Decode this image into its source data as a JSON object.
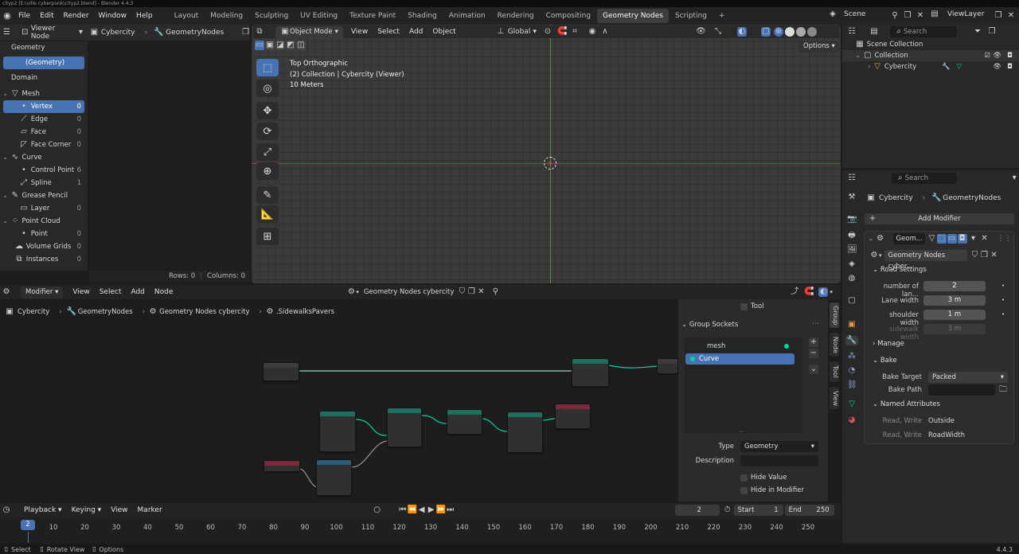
{
  "titlebar": {
    "text": "cityp2 [E:\\ville cyberpunk\\cityp2.blend] - Blender 4.4.3"
  },
  "menu": [
    "File",
    "Edit",
    "Render",
    "Window",
    "Help"
  ],
  "workspaces": [
    "Layout",
    "Modeling",
    "Sculpting",
    "UV Editing",
    "Texture Paint",
    "Shading",
    "Animation",
    "Rendering",
    "Compositing",
    "Geometry Nodes",
    "Scripting"
  ],
  "active_workspace": "Geometry Nodes",
  "scene": {
    "name": "Scene",
    "view_layer": "ViewLayer"
  },
  "spreadsheet": {
    "viewer_node": "Viewer Node",
    "object": "Cybercity",
    "modifier": "GeometryNodes",
    "geometry_label": "Geometry",
    "geometry_item": "(Geometry)",
    "domain_label": "Domain",
    "mesh": {
      "label": "Mesh",
      "items": [
        {
          "label": "Vertex",
          "count": "0"
        },
        {
          "label": "Edge",
          "count": "0"
        },
        {
          "label": "Face",
          "count": "0"
        },
        {
          "label": "Face Corner",
          "count": "0"
        }
      ]
    },
    "curve": {
      "label": "Curve",
      "items": [
        {
          "label": "Control Point",
          "count": "6"
        },
        {
          "label": "Spline",
          "count": "1"
        }
      ]
    },
    "grease_pencil": {
      "label": "Grease Pencil",
      "items": [
        {
          "label": "Layer",
          "count": "0"
        }
      ]
    },
    "point_cloud": {
      "label": "Point Cloud",
      "items": [
        {
          "label": "Point",
          "count": "0"
        }
      ]
    },
    "volume_grids": {
      "label": "Volume Grids",
      "count": "0"
    },
    "instances": {
      "label": "Instances",
      "count": "0"
    },
    "rows": "Rows: 0",
    "columns": "Columns: 0"
  },
  "viewport": {
    "mode": "Object Mode",
    "menus": [
      "View",
      "Select",
      "Add",
      "Object"
    ],
    "orientation": "Global",
    "options": "Options",
    "info_line1": "Top Orthographic",
    "info_line2": "(2) Collection | Cybercity (Viewer)",
    "info_line3": "10 Meters"
  },
  "outliner": {
    "search": "Search",
    "scene_collection": "Scene Collection",
    "collection": "Collection",
    "object": "Cybercity"
  },
  "properties": {
    "search": "Search",
    "object": "Cybercity",
    "modifier_path": "GeometryNodes",
    "add_modifier": "Add Modifier",
    "mod_name": "Geom...",
    "node_group": "Geometry Nodes cyber...",
    "road_settings": "Road settings",
    "params": [
      {
        "label": "number of lan...",
        "value": "2"
      },
      {
        "label": "Lane width",
        "value": "3 m"
      },
      {
        "label": "shoulder width",
        "value": "1 m"
      },
      {
        "label": "sidewalk width",
        "value": "3 m"
      }
    ],
    "manage": "Manage",
    "bake": "Bake",
    "bake_target_label": "Bake Target",
    "bake_target": "Packed",
    "bake_path_label": "Bake Path",
    "named_attributes": "Named Attributes",
    "attrs": [
      {
        "label": "Read, Write",
        "value": "Outside"
      },
      {
        "label": "Read, Write",
        "value": "RoadWidth"
      }
    ]
  },
  "node_editor": {
    "editor_type": "Modifier",
    "menus": [
      "View",
      "Select",
      "Add",
      "Node"
    ],
    "tree_name": "Geometry Nodes cybercity",
    "breadcrumb": [
      "Cybercity",
      "GeometryNodes",
      "Geometry Nodes cybercity",
      ".SidewalksPavers"
    ],
    "sidebar": {
      "tool_label": "Tool",
      "group_sockets": "Group Sockets",
      "sockets": [
        "mesh",
        "Curve"
      ],
      "type_label": "Type",
      "type_value": "Geometry",
      "description_label": "Description",
      "hide_value": "Hide Value",
      "hide_in_modifier": "Hide in Modifier"
    },
    "side_tabs": [
      "Group",
      "Node",
      "Tool",
      "View"
    ]
  },
  "timeline": {
    "menus": [
      "Playback",
      "Keying",
      "View",
      "Marker"
    ],
    "current_frame": "2",
    "start_label": "Start",
    "start": "1",
    "end_label": "End",
    "end": "250",
    "ticks": [
      "10",
      "20",
      "30",
      "40",
      "50",
      "60",
      "70",
      "80",
      "90",
      "100",
      "110",
      "120",
      "130",
      "140",
      "150",
      "160",
      "170",
      "180",
      "190",
      "200",
      "210",
      "220",
      "230",
      "240",
      "250"
    ]
  },
  "statusbar": {
    "select": "Select",
    "rotate": "Rotate View",
    "options": "Options",
    "version": "4.4.3"
  },
  "colors": {
    "accent": "#4772b3",
    "geometry_socket": "#00d6a3",
    "bg": "#1d1d1d"
  }
}
